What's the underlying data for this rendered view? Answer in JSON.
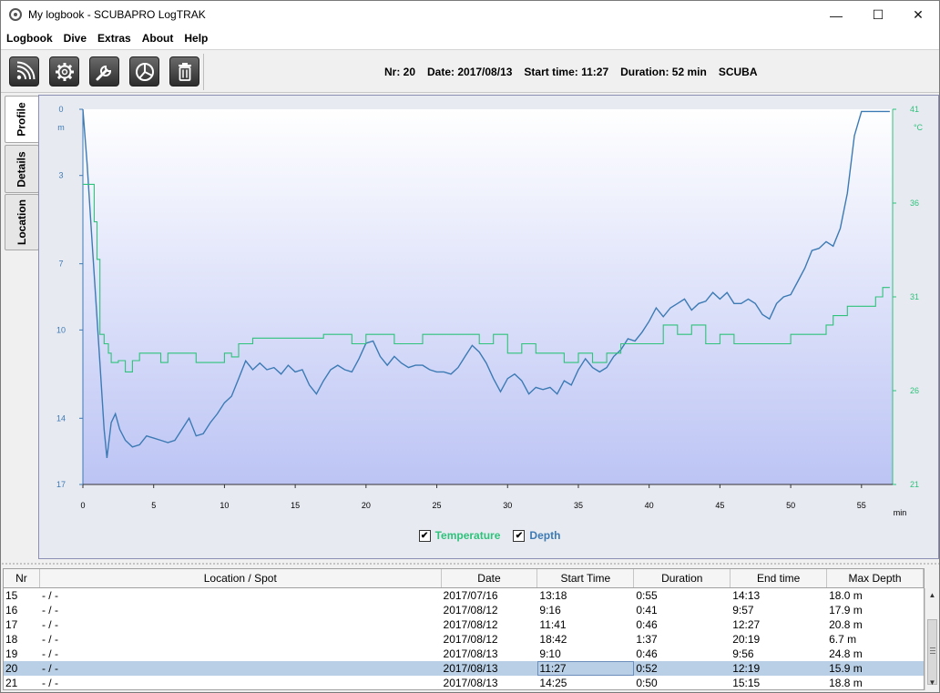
{
  "window": {
    "title": "My logbook - SCUBAPRO LogTRAK",
    "controls": {
      "minimize": "—",
      "maximize": "☐",
      "close": "✕"
    }
  },
  "menu": [
    "Logbook",
    "Dive",
    "Extras",
    "About",
    "Help"
  ],
  "toolbar": {
    "buttons": [
      "download-icon",
      "settings-gear-icon",
      "wrench-icon",
      "pie-chart-icon",
      "trash-icon"
    ],
    "dive_nr": "Nr: 20",
    "dive_date": "Date: 2017/08/13",
    "start_time": "Start time: 11:27",
    "duration": "Duration: 52 min",
    "dive_mode": "SCUBA"
  },
  "side_tabs": [
    "Profile",
    "Details",
    "Location"
  ],
  "active_tab": "Profile",
  "chart_data": {
    "type": "line",
    "x_unit": "min",
    "x_ticks": [
      0,
      5,
      10,
      15,
      20,
      25,
      30,
      35,
      40,
      45,
      50,
      55
    ],
    "xlim": [
      0,
      57.2
    ],
    "depth_axis": {
      "unit": "m",
      "ticks": [
        0,
        3,
        7,
        10,
        14,
        17
      ],
      "range": [
        0,
        17
      ],
      "inverted": true,
      "color": "#3c7ab4"
    },
    "temp_axis": {
      "unit": "°C",
      "ticks": [
        41,
        36,
        31,
        26,
        21
      ],
      "range": [
        21,
        41
      ],
      "color": "#2ec27a"
    },
    "series": [
      {
        "name": "Depth",
        "axis": "depth",
        "x": [
          0,
          0.3,
          0.6,
          0.9,
          1.2,
          1.5,
          1.7,
          2.0,
          2.3,
          2.6,
          3.0,
          3.5,
          4.0,
          4.5,
          5.0,
          5.5,
          6.0,
          6.5,
          7.0,
          7.5,
          8.0,
          8.5,
          9.0,
          9.5,
          10.0,
          10.5,
          11.0,
          11.5,
          12.0,
          12.5,
          13.0,
          13.5,
          14.0,
          14.5,
          15.0,
          15.5,
          16.0,
          16.5,
          17.0,
          17.5,
          18.0,
          18.5,
          19.0,
          19.5,
          20.0,
          20.5,
          21.0,
          21.5,
          22.0,
          22.5,
          23.0,
          23.5,
          24.0,
          24.5,
          25.0,
          25.5,
          26.0,
          26.5,
          27.0,
          27.5,
          28.0,
          28.5,
          29.0,
          29.5,
          30.0,
          30.5,
          31.0,
          31.5,
          32.0,
          32.5,
          33.0,
          33.5,
          34.0,
          34.5,
          35.0,
          35.5,
          36.0,
          36.5,
          37.0,
          37.5,
          38.0,
          38.5,
          39.0,
          39.5,
          40.0,
          40.5,
          41.0,
          41.5,
          42.0,
          42.5,
          43.0,
          43.5,
          44.0,
          44.5,
          45.0,
          45.5,
          46.0,
          46.5,
          47.0,
          47.5,
          48.0,
          48.5,
          49.0,
          49.5,
          50.0,
          50.5,
          51.0,
          51.5,
          52.0,
          52.5,
          53.0,
          53.5,
          54.0,
          54.5,
          55.0,
          55.5,
          56.0,
          56.5,
          57.0
        ],
        "values": [
          0,
          2.5,
          5.5,
          8.5,
          11.5,
          14.5,
          15.8,
          14.2,
          13.8,
          14.5,
          15.0,
          15.3,
          15.2,
          14.8,
          14.9,
          15.0,
          15.1,
          15.0,
          14.5,
          14.0,
          14.8,
          14.7,
          14.2,
          13.8,
          13.3,
          13.0,
          12.2,
          11.4,
          11.8,
          11.5,
          11.8,
          11.7,
          12.0,
          11.6,
          11.9,
          11.8,
          12.5,
          12.9,
          12.3,
          11.8,
          11.6,
          11.8,
          11.9,
          11.3,
          10.6,
          10.5,
          11.2,
          11.6,
          11.2,
          11.5,
          11.7,
          11.6,
          11.6,
          11.8,
          11.9,
          11.9,
          12.0,
          11.7,
          11.2,
          10.7,
          11.0,
          11.5,
          12.2,
          12.8,
          12.2,
          12.0,
          12.3,
          12.9,
          12.6,
          12.7,
          12.6,
          12.9,
          12.3,
          12.5,
          11.8,
          11.3,
          11.7,
          11.9,
          11.7,
          11.2,
          10.9,
          10.4,
          10.5,
          10.1,
          9.6,
          9.0,
          9.4,
          9.0,
          8.8,
          8.6,
          9.1,
          8.8,
          8.7,
          8.3,
          8.6,
          8.3,
          8.8,
          8.8,
          8.6,
          8.8,
          9.3,
          9.5,
          8.8,
          8.5,
          8.4,
          7.8,
          7.2,
          6.4,
          6.3,
          6.0,
          6.2,
          5.4,
          3.8,
          1.2,
          0.1,
          0.1,
          0.1,
          0.1,
          0.1
        ]
      },
      {
        "name": "Temperature",
        "axis": "temp",
        "x": [
          0,
          0.5,
          0.8,
          1.0,
          1.2,
          1.5,
          1.8,
          2.0,
          2.5,
          3.0,
          3.5,
          4.0,
          4.5,
          5.5,
          6.0,
          7.0,
          8.0,
          9.0,
          10.0,
          10.5,
          11.0,
          12.0,
          13.0,
          16.0,
          17.0,
          19.0,
          20.0,
          22.0,
          24.0,
          26.0,
          28.0,
          29.0,
          30.0,
          31.0,
          32.0,
          33.0,
          34.0,
          35.0,
          36.0,
          37.0,
          38.0,
          40.0,
          41.0,
          42.0,
          43.0,
          44.0,
          45.0,
          46.0,
          47.0,
          48.0,
          49.0,
          49.5,
          50.0,
          51.0,
          52.0,
          52.5,
          53.0,
          54.0,
          55.0,
          56.0,
          56.5,
          57.0
        ],
        "values": [
          37,
          37,
          35,
          33,
          29,
          28.5,
          28,
          27.5,
          27.6,
          27,
          27.6,
          28,
          28,
          27.5,
          28,
          28,
          27.5,
          27.5,
          28,
          27.8,
          28.5,
          28.8,
          28.8,
          28.8,
          29,
          28.5,
          29,
          28.5,
          29,
          29,
          28.5,
          29,
          28,
          28.5,
          28,
          28,
          27.5,
          28,
          27.5,
          28,
          28.5,
          28.5,
          29.5,
          29,
          29.5,
          28.5,
          29,
          28.5,
          28.5,
          28.5,
          28.5,
          28.5,
          29,
          29,
          29,
          29.5,
          30,
          30.5,
          30.5,
          31,
          31.5,
          31.5
        ]
      }
    ],
    "legend": [
      "Temperature",
      "Depth"
    ]
  },
  "table": {
    "columns": [
      "Nr",
      "Location / Spot",
      "Date",
      "Start Time",
      "Duration",
      "End time",
      "Max Depth"
    ],
    "rows": [
      [
        "15",
        "- / -",
        "2017/07/16",
        "13:18",
        "0:55",
        "14:13",
        "18.0 m"
      ],
      [
        "16",
        "- / -",
        "2017/08/12",
        "9:16",
        "0:41",
        "9:57",
        "17.9 m"
      ],
      [
        "17",
        "- / -",
        "2017/08/12",
        "11:41",
        "0:46",
        "12:27",
        "20.8 m"
      ],
      [
        "18",
        "- / -",
        "2017/08/12",
        "18:42",
        "1:37",
        "20:19",
        "6.7 m"
      ],
      [
        "19",
        "- / -",
        "2017/08/13",
        "9:10",
        "0:46",
        "9:56",
        "24.8 m"
      ],
      [
        "20",
        "- / -",
        "2017/08/13",
        "11:27",
        "0:52",
        "12:19",
        "15.9 m"
      ],
      [
        "21",
        "- / -",
        "2017/08/13",
        "14:25",
        "0:50",
        "15:15",
        "18.8 m"
      ]
    ],
    "selected_row": 5
  }
}
